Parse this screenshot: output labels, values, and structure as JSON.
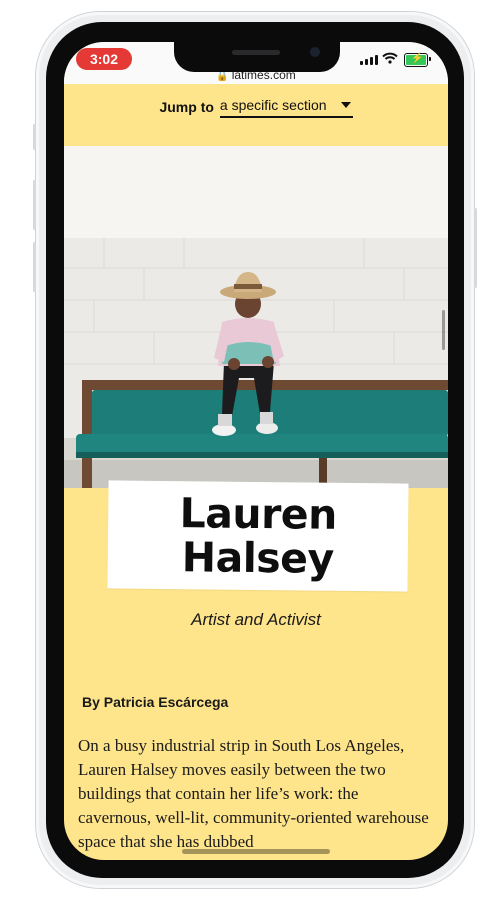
{
  "status_bar": {
    "time": "3:02",
    "url": "latimes.com",
    "icons": [
      "signal-icon",
      "wifi-icon",
      "battery-charging-icon",
      "lock-icon"
    ]
  },
  "jump_nav": {
    "label": "Jump to",
    "selected": "a specific section"
  },
  "article": {
    "title_line1": "Lauren",
    "title_line2": "Halsey",
    "subtitle": "Artist and Activist",
    "byline_prefix": "By",
    "author": "Patricia Escárcega",
    "body": "On a busy industrial strip in South Los Angeles, Lauren Halsey moves easily between the two buildings that contain her life’s work: the cavernous, well-lit, community-oriented warehouse space that she has dubbed"
  },
  "colors": {
    "page_background": "#fee48a",
    "time_pill": "#e53935",
    "battery_fill": "#36c759",
    "bench": "#1d7d78",
    "text": "#111111"
  }
}
